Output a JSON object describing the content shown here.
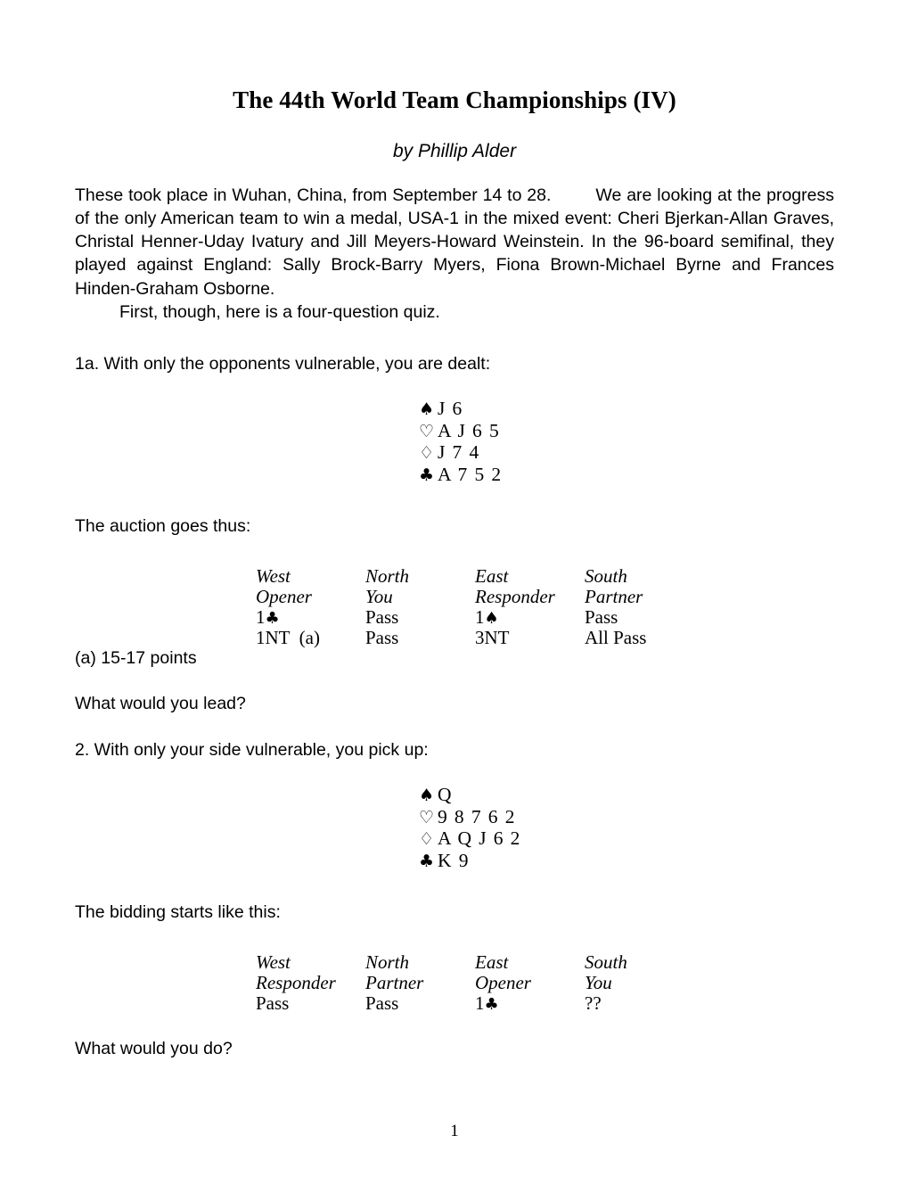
{
  "document": {
    "title": "The 44th World Team Championships (IV)",
    "byline": "by Phillip Alder",
    "page_number": "1"
  },
  "intro": {
    "line1": "These took place in Wuhan, China, from September 14 to 28.",
    "para2": "We are looking at the progress of the only American team to win a medal, USA-1 in the mixed event: Cheri Bjerkan-Allan Graves, Christal Henner-Uday Ivatury and Jill Meyers-Howard Weinstein. In the 96-board semifinal, they played against England: Sally Brock-Barry Myers, Fiona Brown-Michael Byrne and Frances Hinden-Graham Osborne.",
    "para3": "First, though, here is a four-question quiz."
  },
  "question1": {
    "prompt": "1a. With only the opponents vulnerable, you are dealt:",
    "hand": [
      {
        "suit": "♠",
        "ranks": "J 6"
      },
      {
        "suit": "♡",
        "ranks": "A J 6 5"
      },
      {
        "suit": "♢",
        "ranks": "J 7 4"
      },
      {
        "suit": "♣",
        "ranks": "A 7 5 2"
      }
    ],
    "auction_intro": "The auction goes thus:",
    "auction": {
      "seats": [
        "West",
        "North",
        "East",
        "South"
      ],
      "roles": [
        "Opener",
        "You",
        "Responder",
        "Partner"
      ],
      "rows": [
        [
          {
            "text": "1",
            "suit": "♣",
            "after": ""
          },
          {
            "text": "Pass",
            "suit": "",
            "after": ""
          },
          {
            "text": "1",
            "suit": "♠",
            "after": ""
          },
          {
            "text": "Pass",
            "suit": "",
            "after": ""
          }
        ],
        [
          {
            "text": "1NT",
            "suit": "",
            "after": "  (a)"
          },
          {
            "text": "Pass",
            "suit": "",
            "after": ""
          },
          {
            "text": "3NT",
            "suit": "",
            "after": ""
          },
          {
            "text": "All Pass",
            "suit": "",
            "after": ""
          }
        ]
      ]
    },
    "footnote": "(a) 15-17 points",
    "closing": "What would you lead?"
  },
  "question2": {
    "prompt": "2. With only your side vulnerable, you pick up:",
    "hand": [
      {
        "suit": "♠",
        "ranks": "Q"
      },
      {
        "suit": "♡",
        "ranks": "9 8 7 6 2"
      },
      {
        "suit": "♢",
        "ranks": "A Q J 6 2"
      },
      {
        "suit": "♣",
        "ranks": "K 9"
      }
    ],
    "auction_intro": "The bidding starts like this:",
    "auction": {
      "seats": [
        "West",
        "North",
        "East",
        "South"
      ],
      "roles": [
        "Responder",
        "Partner",
        "Opener",
        "You"
      ],
      "rows": [
        [
          {
            "text": "Pass",
            "suit": "",
            "after": ""
          },
          {
            "text": "Pass",
            "suit": "",
            "after": ""
          },
          {
            "text": "1",
            "suit": "♣",
            "after": ""
          },
          {
            "text": "??",
            "suit": "",
            "after": ""
          }
        ]
      ]
    },
    "closing": "What would you do?"
  }
}
